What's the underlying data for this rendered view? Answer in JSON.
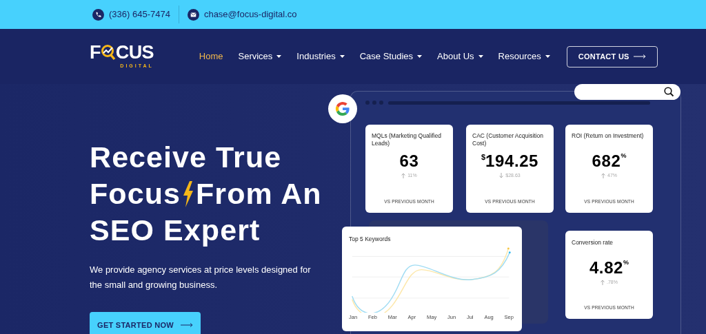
{
  "topbar": {
    "phone": "(336) 645-7474",
    "email": "chase@focus-digital.co"
  },
  "logo": {
    "lead": "F",
    "tail": "CUS",
    "sub": "DIGITAL"
  },
  "nav": [
    {
      "label": "Home",
      "selected": true,
      "dropdown": false
    },
    {
      "label": "Services",
      "selected": false,
      "dropdown": true
    },
    {
      "label": "Industries",
      "selected": false,
      "dropdown": true
    },
    {
      "label": "Case Studies",
      "selected": false,
      "dropdown": true
    },
    {
      "label": "About Us",
      "selected": false,
      "dropdown": true
    },
    {
      "label": "Resources",
      "selected": false,
      "dropdown": true
    }
  ],
  "contact_button": "CONTACT US",
  "hero": {
    "headline": [
      [
        "Receive True"
      ],
      [
        "Focus",
        "From An"
      ],
      [
        "SEO Expert"
      ]
    ],
    "subtitle": "We provide agency services at price levels designed for the small and growing business.",
    "cta": "GET STARTED NOW"
  },
  "metrics": [
    {
      "title": "MQLs (Marketing Qualified Leads)",
      "value": "63",
      "change": "11%",
      "kind": "up",
      "footer": "VS PREVIOUS MONTH"
    },
    {
      "title": "CAC (Customer Acquisition Cost)",
      "prefix": "$",
      "value": "194.25",
      "change": "$28.63",
      "kind": "down",
      "footer": "VS PREVIOUS MONTH"
    },
    {
      "title": "ROI (Return on Investment)",
      "value": "682",
      "suffix": "%",
      "change": "47%",
      "kind": "up",
      "footer": "VS PREVIOUS MONTH"
    },
    {
      "title": "Conversion rate",
      "value": "4.82",
      "suffix": "%",
      "change": ".78%",
      "kind": "up",
      "footer": "VS PREVIOUS MONTH"
    }
  ],
  "keywords_chart": {
    "title": "Top 5 Keywords",
    "x_labels": [
      "Jan",
      "Feb",
      "Mar",
      "Apr",
      "May",
      "Jun",
      "Jul",
      "Aug",
      "Sep"
    ]
  }
}
